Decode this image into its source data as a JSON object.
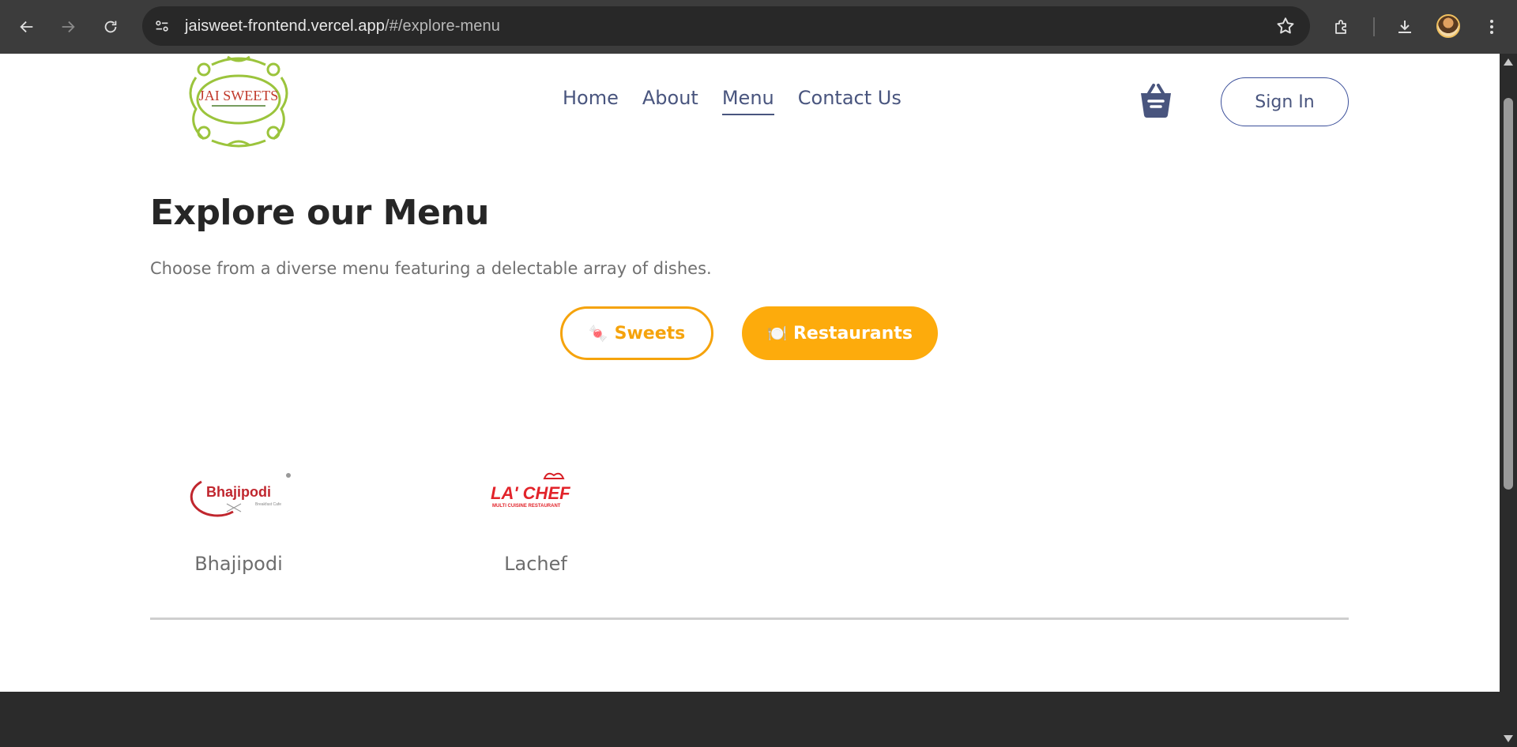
{
  "browser": {
    "url_host": "jaisweet-frontend.vercel.app",
    "url_path": "/#/explore-menu"
  },
  "header": {
    "logo_text": "JAI SWEETS",
    "nav": [
      {
        "label": "Home",
        "active": false
      },
      {
        "label": "About",
        "active": false
      },
      {
        "label": "Menu",
        "active": true
      },
      {
        "label": "Contact Us",
        "active": false
      }
    ],
    "sign_in_label": "Sign In"
  },
  "main": {
    "title": "Explore our Menu",
    "subtitle": "Choose from a diverse menu featuring a delectable array of dishes.",
    "toggle": {
      "sweets_label": "Sweets",
      "sweets_icon": "🍬",
      "restaurants_label": "Restaurants",
      "restaurants_icon": "🍽️",
      "selected": "Restaurants"
    },
    "restaurants": [
      {
        "name": "Bhajipodi",
        "logo_text": "Bhajipodi"
      },
      {
        "name": "Lachef",
        "logo_text": "LA' CHEF"
      }
    ]
  },
  "colors": {
    "accent": "#fdab0c",
    "nav_text": "#49557e",
    "title": "#262626"
  }
}
